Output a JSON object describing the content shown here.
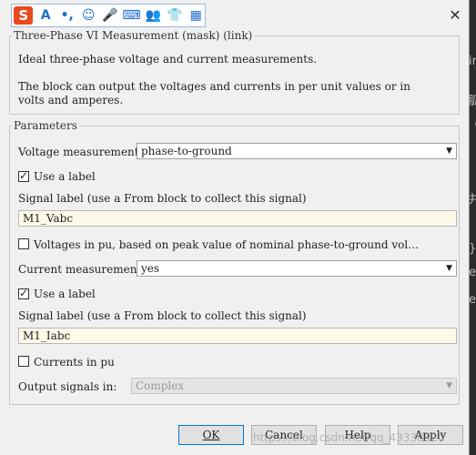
{
  "ime_toolbar": {
    "logo": "S",
    "buttons": [
      {
        "name": "ime-font-icon",
        "glyph": "A"
      },
      {
        "name": "ime-punct-icon",
        "glyph": "•,"
      },
      {
        "name": "ime-emoji-icon",
        "glyph": "☺"
      },
      {
        "name": "ime-mic-icon",
        "glyph": "🎤"
      },
      {
        "name": "ime-keyboard-icon",
        "glyph": "⌨"
      },
      {
        "name": "ime-user-icon",
        "glyph": "👥"
      },
      {
        "name": "ime-skin-icon",
        "glyph": "👕"
      },
      {
        "name": "ime-grid-icon",
        "glyph": "▦"
      }
    ]
  },
  "close_glyph": "✕",
  "description": {
    "title": "Three-Phase VI Measurement (mask) (link)",
    "line1": "Ideal three-phase voltage and current measurements.",
    "line2": "The block can output the voltages and currents in per unit values or in",
    "line3": "volts and amperes."
  },
  "parameters": {
    "title": "Parameters",
    "voltage_measurement_label": "Voltage measurement",
    "voltage_measurement_value": "phase-to-ground",
    "use_label_1": "Use a label",
    "use_label_1_checked": true,
    "signal_label_1": "Signal label  (use a From block to collect this signal)",
    "signal_value_1": "M1_Vabc",
    "voltages_pu_label": "Voltages in pu,  based on peak value of nominal phase-to-ground vol…",
    "voltages_pu_checked": false,
    "current_measurement_label": "Current measurement",
    "current_measurement_value": "yes",
    "use_label_2": "Use a label",
    "use_label_2_checked": true,
    "signal_label_2": "Signal label  (use a From block to collect this signal)",
    "signal_value_2": "M1_Iabc",
    "currents_pu_label": "Currents in pu",
    "currents_pu_checked": false,
    "output_signals_label": "Output signals in:",
    "output_signals_value": "Complex"
  },
  "buttons": {
    "ok": "OK",
    "cancel": "Cancel",
    "help": "Help",
    "apply": "Apply"
  },
  "watermark": "https://blog.csdn.net/qq_43338520",
  "background_text": [
    "ir",
    "胍",
    "《",
    "并",
    "}",
    "e",
    "e"
  ]
}
